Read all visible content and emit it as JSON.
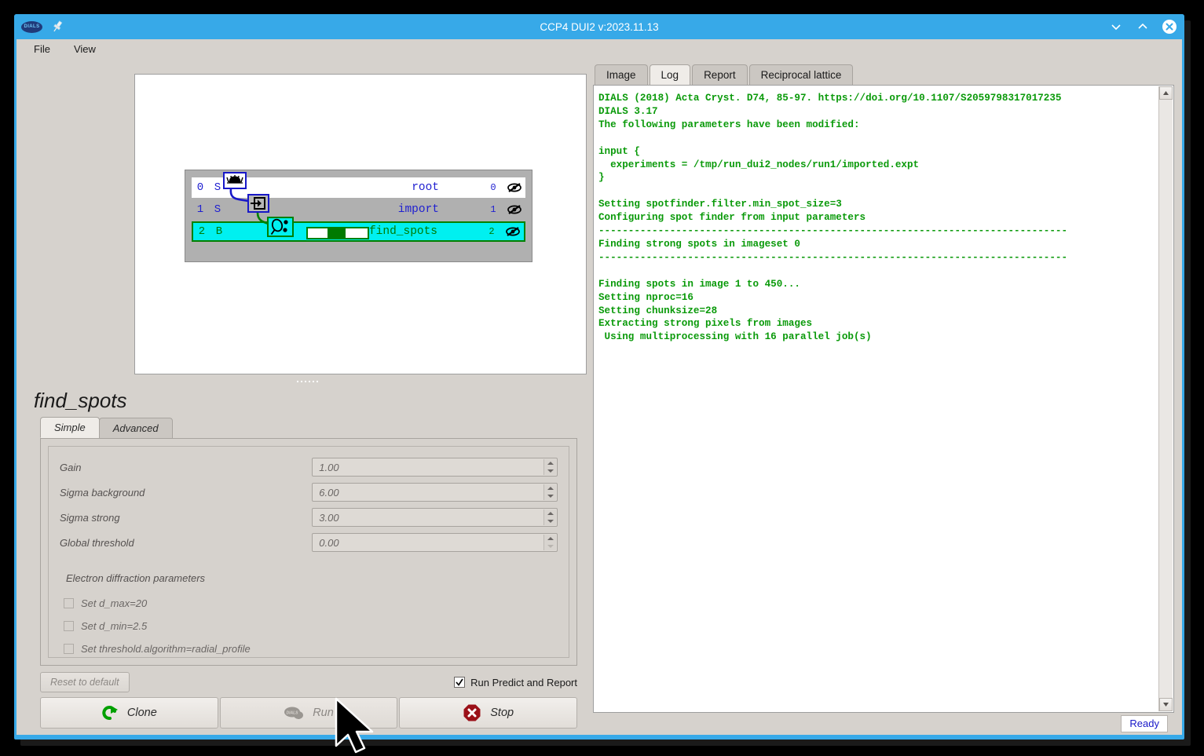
{
  "window": {
    "title": "CCP4 DUI2 v:2023.11.13",
    "logo_text": "DIALS",
    "icons": {
      "logo": "dials-logo-icon",
      "pin": "pin-icon",
      "minimize": "chevron-down-icon",
      "maximize": "chevron-up-icon",
      "close": "close-circle-icon"
    }
  },
  "menubar": {
    "items": [
      {
        "label": "File"
      },
      {
        "label": "View"
      }
    ]
  },
  "tree": {
    "rows": [
      {
        "index": "0",
        "state": "S",
        "name": "root",
        "count": "0",
        "icon": "eyelash-box-icon",
        "eye": "eye-hidden-icon",
        "selected": false,
        "progress": false
      },
      {
        "index": "1",
        "state": "S",
        "name": "import",
        "count": "1",
        "icon": "import-arrow-icon",
        "eye": "eye-hidden-icon",
        "selected": false,
        "progress": false
      },
      {
        "index": "2",
        "state": "B",
        "name": "find_spots",
        "count": "2",
        "icon": "spotfinder-icon",
        "eye": "eye-hidden-icon",
        "selected": true,
        "progress": true
      }
    ],
    "colors": {
      "selected_bg": "#00f0f0",
      "selected_fg": "#007a00",
      "normal_fg": "#2020d0",
      "alt_row_bg": "#b0b0b0",
      "progress_fill": "#007a00"
    }
  },
  "panel": {
    "title": "find_spots",
    "tabs": [
      {
        "label": "Simple",
        "active": true
      },
      {
        "label": "Advanced",
        "active": false
      }
    ],
    "fields": [
      {
        "label": "Gain",
        "value": "1.00",
        "up_enabled": true,
        "down_enabled": true
      },
      {
        "label": "Sigma background",
        "value": "6.00",
        "up_enabled": true,
        "down_enabled": true
      },
      {
        "label": "Sigma strong",
        "value": "3.00",
        "up_enabled": true,
        "down_enabled": true
      },
      {
        "label": "Global threshold",
        "value": "0.00",
        "up_enabled": true,
        "down_enabled": false
      }
    ],
    "section_label": "Electron diffraction parameters",
    "checkboxes": [
      {
        "label": "Set d_max=20",
        "checked": false
      },
      {
        "label": "Set d_min=2.5",
        "checked": false
      },
      {
        "label": "Set threshold.algorithm=radial_profile",
        "checked": false
      }
    ],
    "reset_label": "Reset to default",
    "run_predict_label": "Run Predict and Report",
    "run_predict_checked": true,
    "actions": [
      {
        "label": "Clone",
        "icon": "clone-arrow-icon",
        "disabled": false
      },
      {
        "label": "Run",
        "icon": "dials-run-icon",
        "disabled": true
      },
      {
        "label": "Stop",
        "icon": "stop-octagon-icon",
        "disabled": false
      }
    ]
  },
  "output": {
    "tabs": [
      {
        "label": "Image",
        "active": false
      },
      {
        "label": "Log",
        "active": true
      },
      {
        "label": "Report",
        "active": false
      },
      {
        "label": "Reciprocal lattice",
        "active": false
      }
    ],
    "log": "DIALS (2018) Acta Cryst. D74, 85-97. https://doi.org/10.1107/S2059798317017235\nDIALS 3.17\nThe following parameters have been modified:\n\ninput {\n  experiments = /tmp/run_dui2_nodes/run1/imported.expt\n}\n\nSetting spotfinder.filter.min_spot_size=3\nConfiguring spot finder from input parameters\n-------------------------------------------------------------------------------\nFinding strong spots in imageset 0\n-------------------------------------------------------------------------------\n\nFinding spots in image 1 to 450...\nSetting nproc=16\nSetting chunksize=28\nExtracting strong pixels from images\n Using multiprocessing with 16 parallel job(s)",
    "log_color": "#0a9a0a"
  },
  "statusbar": {
    "text": "Ready"
  }
}
